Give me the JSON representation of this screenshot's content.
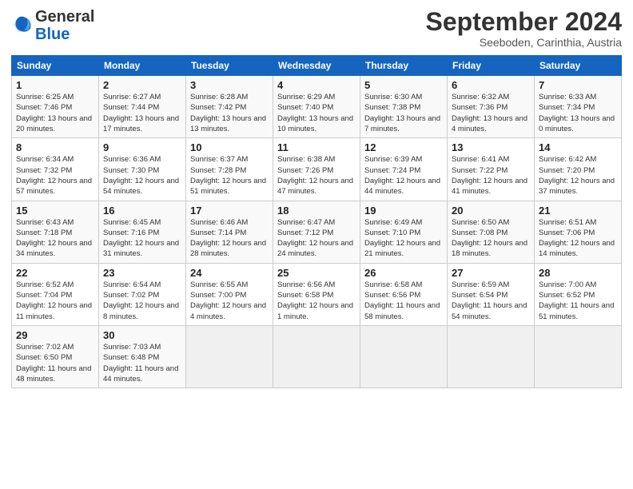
{
  "logo": {
    "line1": "General",
    "line2": "Blue"
  },
  "header": {
    "month": "September 2024",
    "location": "Seeboden, Carinthia, Austria"
  },
  "weekdays": [
    "Sunday",
    "Monday",
    "Tuesday",
    "Wednesday",
    "Thursday",
    "Friday",
    "Saturday"
  ],
  "weeks": [
    [
      {
        "day": "1",
        "sunrise": "6:25 AM",
        "sunset": "7:46 PM",
        "daylight": "13 hours and 20 minutes."
      },
      {
        "day": "2",
        "sunrise": "6:27 AM",
        "sunset": "7:44 PM",
        "daylight": "13 hours and 17 minutes."
      },
      {
        "day": "3",
        "sunrise": "6:28 AM",
        "sunset": "7:42 PM",
        "daylight": "13 hours and 13 minutes."
      },
      {
        "day": "4",
        "sunrise": "6:29 AM",
        "sunset": "7:40 PM",
        "daylight": "13 hours and 10 minutes."
      },
      {
        "day": "5",
        "sunrise": "6:30 AM",
        "sunset": "7:38 PM",
        "daylight": "13 hours and 7 minutes."
      },
      {
        "day": "6",
        "sunrise": "6:32 AM",
        "sunset": "7:36 PM",
        "daylight": "13 hours and 4 minutes."
      },
      {
        "day": "7",
        "sunrise": "6:33 AM",
        "sunset": "7:34 PM",
        "daylight": "13 hours and 0 minutes."
      }
    ],
    [
      {
        "day": "8",
        "sunrise": "6:34 AM",
        "sunset": "7:32 PM",
        "daylight": "12 hours and 57 minutes."
      },
      {
        "day": "9",
        "sunrise": "6:36 AM",
        "sunset": "7:30 PM",
        "daylight": "12 hours and 54 minutes."
      },
      {
        "day": "10",
        "sunrise": "6:37 AM",
        "sunset": "7:28 PM",
        "daylight": "12 hours and 51 minutes."
      },
      {
        "day": "11",
        "sunrise": "6:38 AM",
        "sunset": "7:26 PM",
        "daylight": "12 hours and 47 minutes."
      },
      {
        "day": "12",
        "sunrise": "6:39 AM",
        "sunset": "7:24 PM",
        "daylight": "12 hours and 44 minutes."
      },
      {
        "day": "13",
        "sunrise": "6:41 AM",
        "sunset": "7:22 PM",
        "daylight": "12 hours and 41 minutes."
      },
      {
        "day": "14",
        "sunrise": "6:42 AM",
        "sunset": "7:20 PM",
        "daylight": "12 hours and 37 minutes."
      }
    ],
    [
      {
        "day": "15",
        "sunrise": "6:43 AM",
        "sunset": "7:18 PM",
        "daylight": "12 hours and 34 minutes."
      },
      {
        "day": "16",
        "sunrise": "6:45 AM",
        "sunset": "7:16 PM",
        "daylight": "12 hours and 31 minutes."
      },
      {
        "day": "17",
        "sunrise": "6:46 AM",
        "sunset": "7:14 PM",
        "daylight": "12 hours and 28 minutes."
      },
      {
        "day": "18",
        "sunrise": "6:47 AM",
        "sunset": "7:12 PM",
        "daylight": "12 hours and 24 minutes."
      },
      {
        "day": "19",
        "sunrise": "6:49 AM",
        "sunset": "7:10 PM",
        "daylight": "12 hours and 21 minutes."
      },
      {
        "day": "20",
        "sunrise": "6:50 AM",
        "sunset": "7:08 PM",
        "daylight": "12 hours and 18 minutes."
      },
      {
        "day": "21",
        "sunrise": "6:51 AM",
        "sunset": "7:06 PM",
        "daylight": "12 hours and 14 minutes."
      }
    ],
    [
      {
        "day": "22",
        "sunrise": "6:52 AM",
        "sunset": "7:04 PM",
        "daylight": "12 hours and 11 minutes."
      },
      {
        "day": "23",
        "sunrise": "6:54 AM",
        "sunset": "7:02 PM",
        "daylight": "12 hours and 8 minutes."
      },
      {
        "day": "24",
        "sunrise": "6:55 AM",
        "sunset": "7:00 PM",
        "daylight": "12 hours and 4 minutes."
      },
      {
        "day": "25",
        "sunrise": "6:56 AM",
        "sunset": "6:58 PM",
        "daylight": "12 hours and 1 minute."
      },
      {
        "day": "26",
        "sunrise": "6:58 AM",
        "sunset": "6:56 PM",
        "daylight": "11 hours and 58 minutes."
      },
      {
        "day": "27",
        "sunrise": "6:59 AM",
        "sunset": "6:54 PM",
        "daylight": "11 hours and 54 minutes."
      },
      {
        "day": "28",
        "sunrise": "7:00 AM",
        "sunset": "6:52 PM",
        "daylight": "11 hours and 51 minutes."
      }
    ],
    [
      {
        "day": "29",
        "sunrise": "7:02 AM",
        "sunset": "6:50 PM",
        "daylight": "11 hours and 48 minutes."
      },
      {
        "day": "30",
        "sunrise": "7:03 AM",
        "sunset": "6:48 PM",
        "daylight": "11 hours and 44 minutes."
      },
      {
        "day": "",
        "sunrise": "",
        "sunset": "",
        "daylight": ""
      },
      {
        "day": "",
        "sunrise": "",
        "sunset": "",
        "daylight": ""
      },
      {
        "day": "",
        "sunrise": "",
        "sunset": "",
        "daylight": ""
      },
      {
        "day": "",
        "sunrise": "",
        "sunset": "",
        "daylight": ""
      },
      {
        "day": "",
        "sunrise": "",
        "sunset": "",
        "daylight": ""
      }
    ]
  ]
}
